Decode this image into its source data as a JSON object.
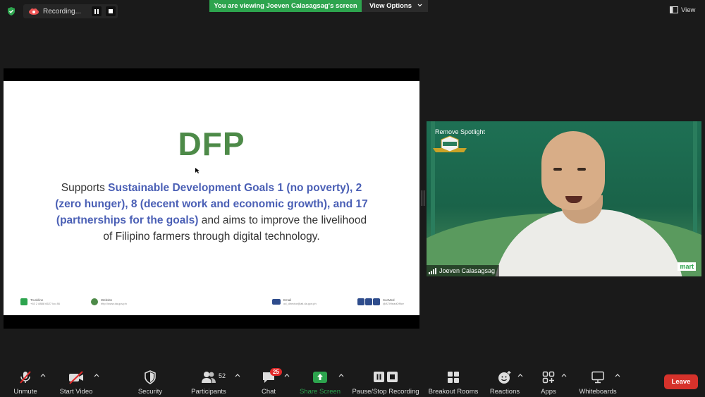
{
  "recording": {
    "label": "Recording..."
  },
  "banner": {
    "viewing_text": "You are viewing Joeven Calasagsag's screen",
    "view_options": "View Options"
  },
  "top_right": {
    "view_label": "View"
  },
  "slide": {
    "title": "DFP",
    "body_prefix": "Supports ",
    "body_highlight": "Sustainable Development Goals 1 (no poverty), 2 (zero hunger), 8 (decent work and economic growth), and 17 (partnerships for the goals)",
    "body_suffix": " and  aims to improve the livelihood of Filipino farmers through digital technology.",
    "footer": [
      {
        "label": "Trunkline",
        "value": "+63 2 8888 6627 loc 86",
        "icon_color": "#2da44e"
      },
      {
        "label": "Website",
        "value": "http://www.da.gov.ph",
        "icon_color": "#4d8a48"
      },
      {
        "label": "Email",
        "value": "od_director@ati.da.gov.ph",
        "icon_color": "#2e4c8c"
      },
      {
        "label": "SocMed",
        "value": "@ATIHeadOffice",
        "icon_color": "#2e4c8c"
      }
    ]
  },
  "video": {
    "spotlight_label": "Remove Spotlight",
    "participant_name": "Joeven Calasagsag",
    "brand_text": "mart"
  },
  "toolbar": {
    "unmute": "Unmute",
    "start_video": "Start Video",
    "security": "Security",
    "participants": "Participants",
    "participants_count": "52",
    "chat": "Chat",
    "chat_badge": "25",
    "share_screen": "Share Screen",
    "pause_stop_recording": "Pause/Stop Recording",
    "breakout_rooms": "Breakout Rooms",
    "reactions": "Reactions",
    "apps": "Apps",
    "whiteboards": "Whiteboards",
    "leave": "Leave"
  },
  "colors": {
    "banner_green": "#2da44e",
    "leave_red": "#d6322b",
    "slide_title_green": "#4d8a48",
    "slide_highlight_blue": "#4a5fb5",
    "chat_badge_red": "#e02828",
    "share_green": "#2da44e"
  }
}
